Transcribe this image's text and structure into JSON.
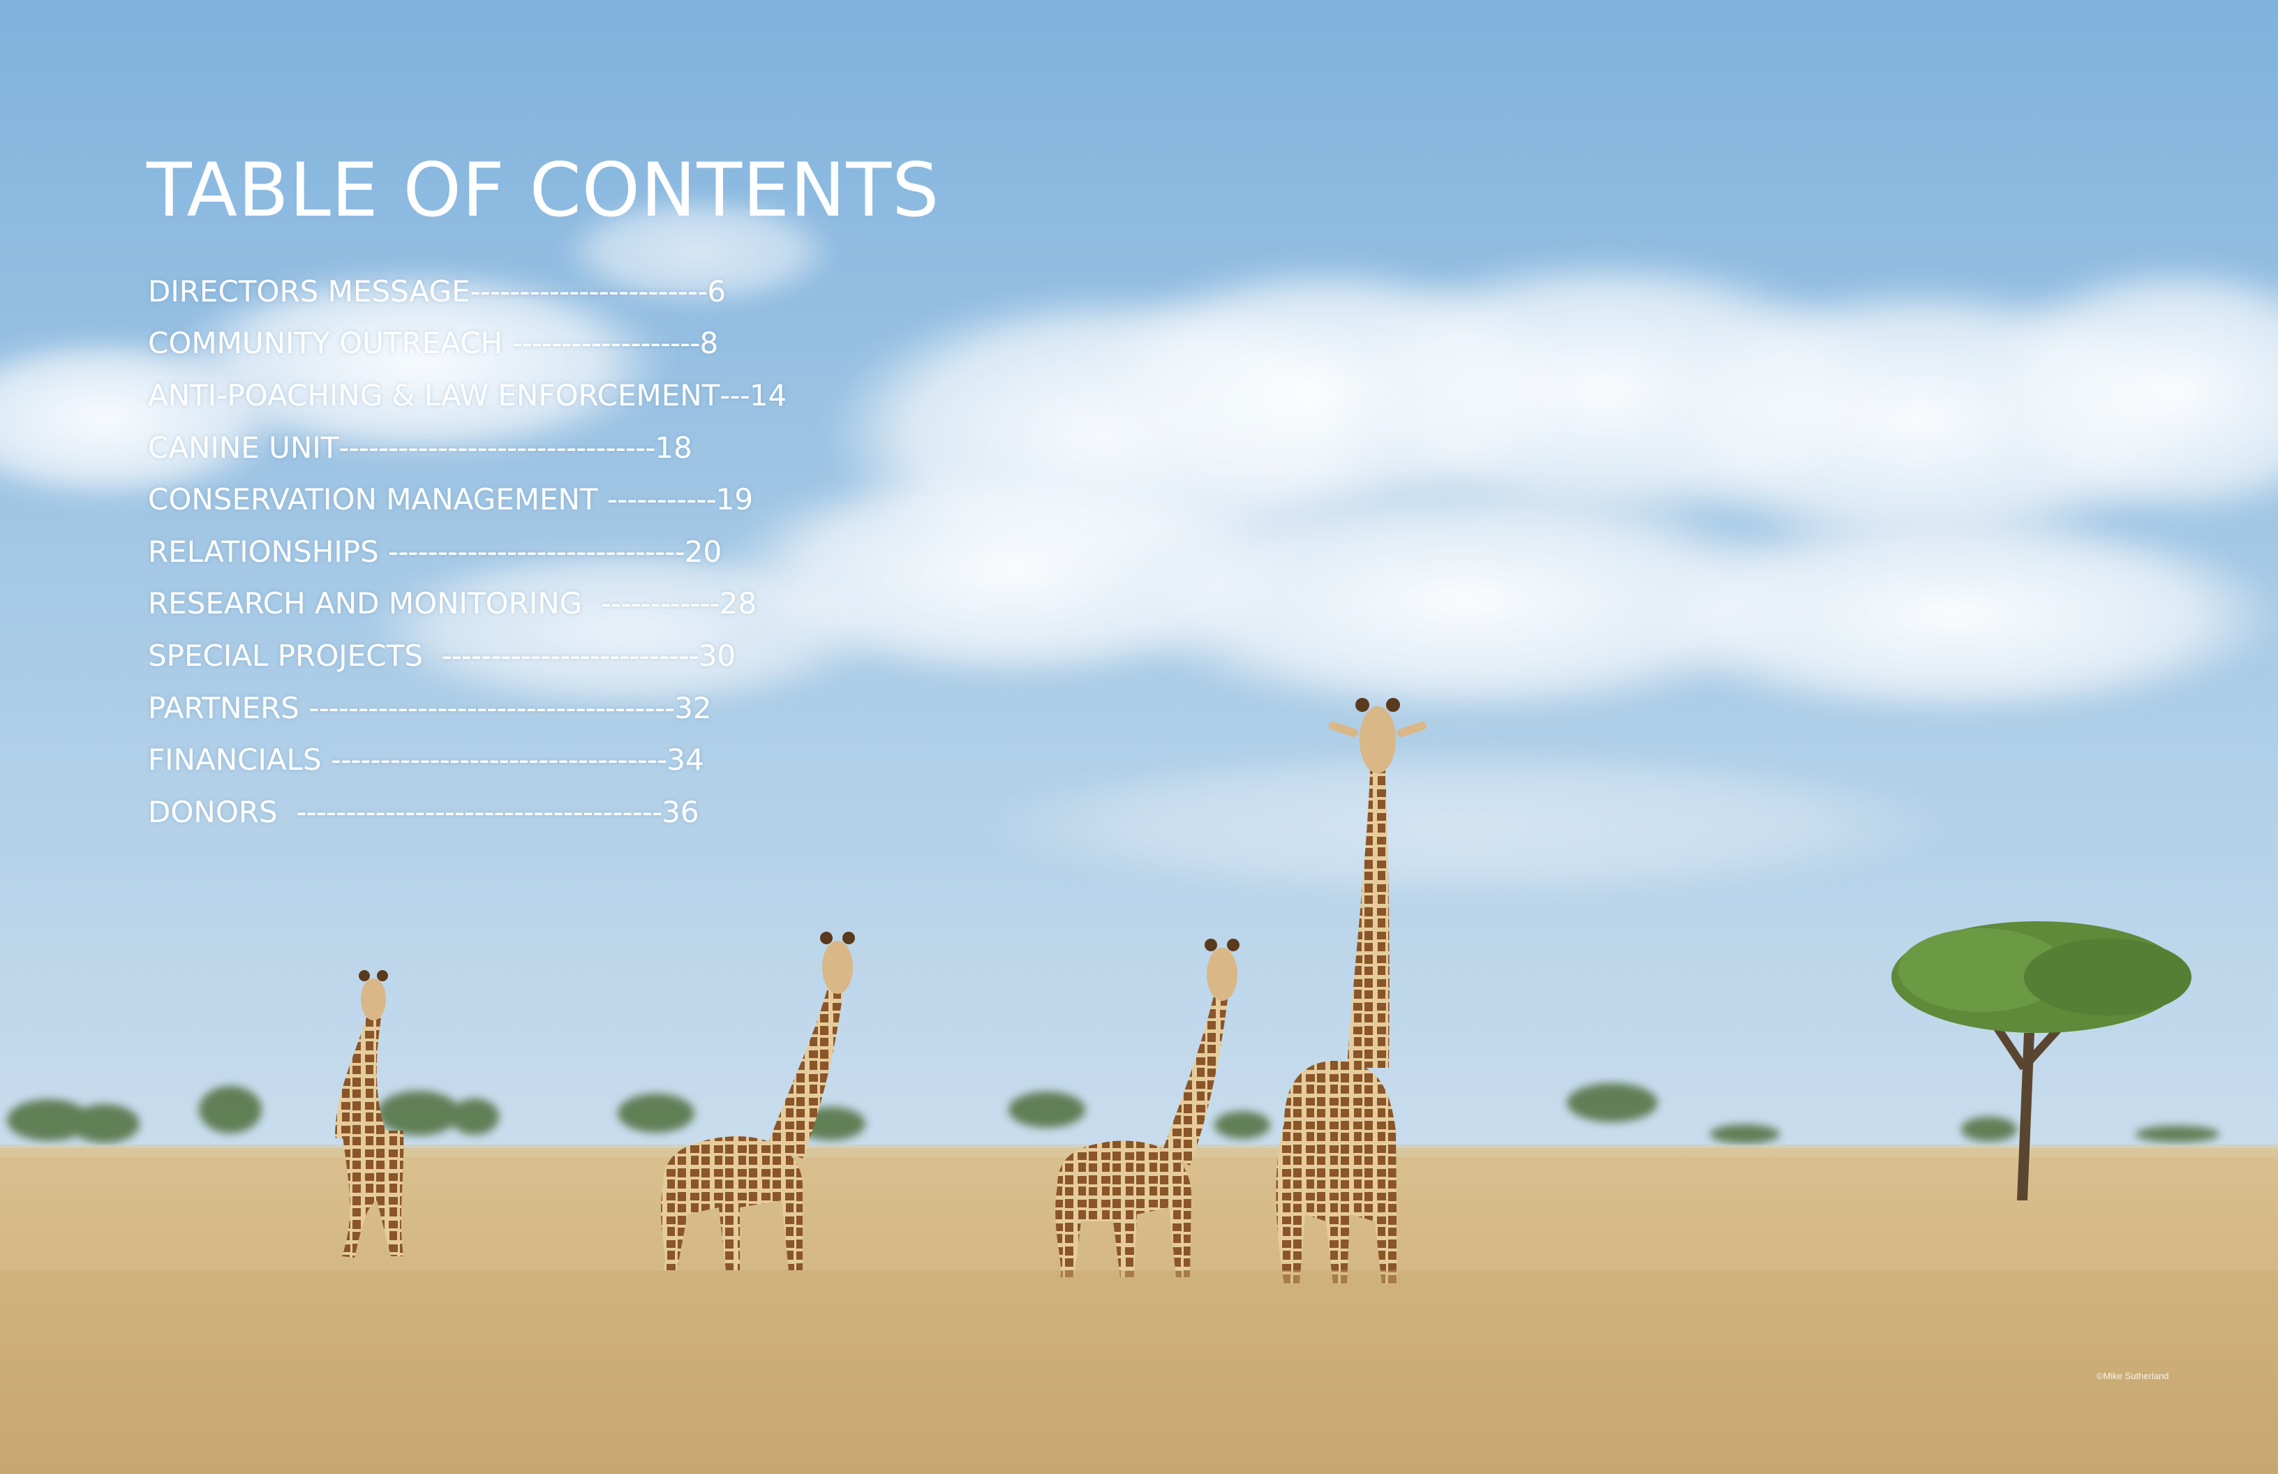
{
  "toc": {
    "title": "TABLE OF CONTENTS",
    "entries": [
      {
        "label": "DIRECTORS MESSAGE",
        "leader": "------------------------",
        "page": "6"
      },
      {
        "label": "COMMUNITY OUTREACH ",
        "leader": "-------------------",
        "page": "8"
      },
      {
        "label": "ANTI-POACHING & LAW ENFORCEMENT",
        "leader": "---",
        "page": "14"
      },
      {
        "label": "CANINE UNIT",
        "leader": "--------------------------------",
        "page": "18"
      },
      {
        "label": "CONSERVATION MANAGEMENT ",
        "leader": "-----------",
        "page": "19"
      },
      {
        "label": "RELATIONSHIPS ",
        "leader": "------------------------------",
        "page": "20"
      },
      {
        "label": "RESEARCH AND MONITORING  ",
        "leader": "------------",
        "page": "28"
      },
      {
        "label": "SPECIAL PROJECTS  ",
        "leader": "--------------------------",
        "page": "30"
      },
      {
        "label": "PARTNERS ",
        "leader": "-------------------------------------",
        "page": "32"
      },
      {
        "label": "FINANCIALS ",
        "leader": "----------------------------------",
        "page": "34"
      },
      {
        "label": "DONORS  ",
        "leader": "-------------------------------------",
        "page": "36"
      }
    ]
  },
  "photo_credit": "©Mike Sutherland",
  "colors": {
    "sky_top": "#7fb2dd",
    "sky_bottom": "#c7dcea",
    "grass": "#d2b582",
    "giraffe_base": "#e6cc9c",
    "giraffe_patch": "#7a4a22",
    "tree": "#5e8a3a",
    "text": "#ffffff"
  }
}
